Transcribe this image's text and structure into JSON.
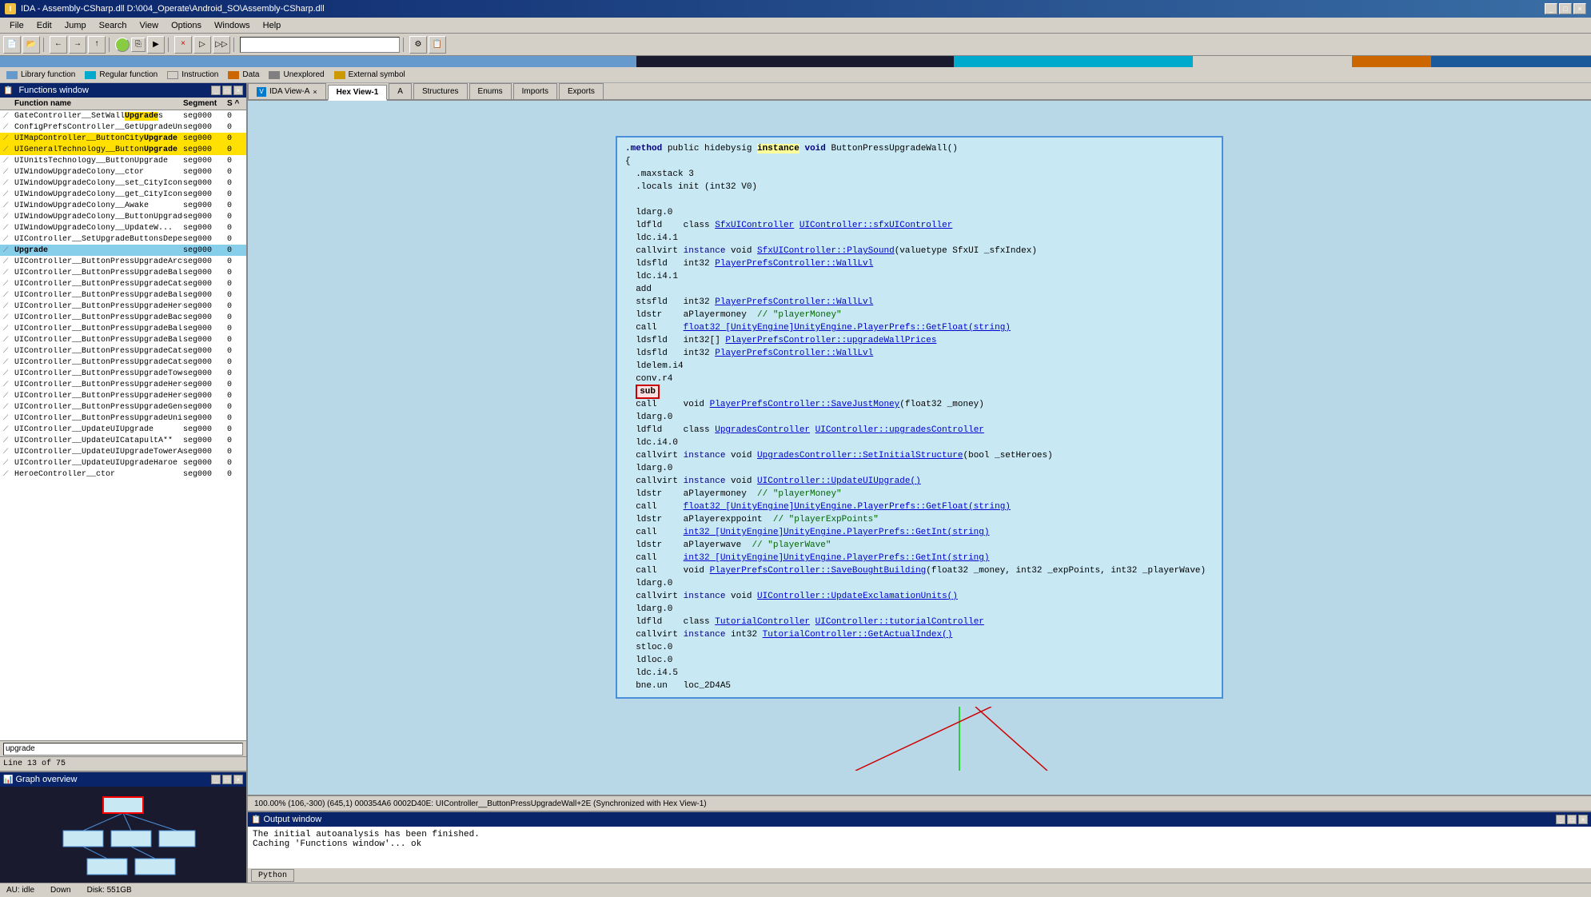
{
  "window": {
    "title": "IDA - Assembly-CSharp.dll D:\\004_Operate\\Android_SO\\Assembly-CSharp.dll"
  },
  "menu": {
    "items": [
      "File",
      "Edit",
      "Jump",
      "Search",
      "View",
      "Options",
      "Windows",
      "Help"
    ]
  },
  "legend": {
    "items": [
      {
        "label": "Library function",
        "color": "#6699cc"
      },
      {
        "label": "Regular function",
        "color": "#00aacc"
      },
      {
        "label": "Instruction",
        "color": "#d4d0c8"
      },
      {
        "label": "Data",
        "color": "#cc6600"
      },
      {
        "label": "Unexplored",
        "color": "#808080"
      },
      {
        "label": "External symbol",
        "color": "#cc9900"
      }
    ]
  },
  "functions_panel": {
    "title": "Functions window",
    "columns": [
      "Function name",
      "Segment",
      "S ^"
    ],
    "rows": [
      {
        "name": "GateController__SetWall",
        "highlight": "Upgrade",
        "seg": "seg000",
        "s": "0",
        "type": "fn"
      },
      {
        "name": "ConfigPrefsController__GetUpgradeUnit",
        "highlight": "Upgrade",
        "seg": "seg000",
        "s": "0",
        "type": "fn"
      },
      {
        "name": "UIMapController__ButtonCity",
        "highlight": "Upgrade",
        "seg": "seg000",
        "s": "0",
        "type": "fn",
        "bg": "yellow"
      },
      {
        "name": "UIGeneralTechnology__Button",
        "highlight": "Upgrade",
        "seg": "seg000",
        "s": "0",
        "type": "fn",
        "bg": "yellow"
      },
      {
        "name": "UIUnitsTechnology__ButtonUpgrade",
        "highlight": "",
        "seg": "seg000",
        "s": "0",
        "type": "fn"
      },
      {
        "name": "UIWindowUpgradeColony__ctor",
        "highlight": "",
        "seg": "seg000",
        "s": "0",
        "type": "fn"
      },
      {
        "name": "UIWindowUpgradeColony__set_CityIcon",
        "highlight": "",
        "seg": "seg000",
        "s": "0",
        "type": "fn"
      },
      {
        "name": "UIWindowUpgradeColony__get_CityIcon",
        "highlight": "",
        "seg": "seg000",
        "s": "0",
        "type": "fn"
      },
      {
        "name": "UIWindowUpgradeColony__Awake",
        "highlight": "",
        "seg": "seg000",
        "s": "0",
        "type": "fn"
      },
      {
        "name": "UIWindowUpgradeColony__ButtonUpgradeCity",
        "highlight": "",
        "seg": "seg000",
        "s": "0",
        "type": "fn"
      },
      {
        "name": "UIWindowUpgradeColony__UpdateWindow",
        "highlight": "",
        "seg": "seg000",
        "s": "0",
        "type": "fn"
      },
      {
        "name": "UIController__SetUpgradeButtonsDepend",
        "highlight": "",
        "seg": "seg000",
        "s": "0",
        "type": "fn"
      },
      {
        "name": "Upgrade",
        "highlight": "",
        "seg": "seg000",
        "s": "0",
        "type": "fn",
        "selected": true
      },
      {
        "name": "UIController__ButtonPressUpgradeArcher",
        "highlight": "",
        "seg": "seg000",
        "s": "0",
        "type": "fn"
      },
      {
        "name": "UIController__ButtonPressUpgradeBallista",
        "highlight": "",
        "seg": "seg000",
        "s": "0",
        "type": "fn"
      },
      {
        "name": "UIController__ButtonPressUpgradeCatapult",
        "highlight": "",
        "seg": "seg000",
        "s": "0",
        "type": "fn"
      },
      {
        "name": "UIController__ButtonPressUpgradeBalli**",
        "highlight": "",
        "seg": "seg000",
        "s": "0",
        "type": "fn"
      },
      {
        "name": "UIController__ButtonPressUpgradeHeroe",
        "highlight": "",
        "seg": "seg000",
        "s": "0",
        "type": "fn"
      },
      {
        "name": "UIController__ButtonPressUpgradeBack",
        "highlight": "",
        "seg": "seg000",
        "s": "0",
        "type": "fn"
      },
      {
        "name": "UIController__ButtonPressUpgradeBalli**",
        "highlight": "",
        "seg": "seg000",
        "s": "0",
        "type": "fn"
      },
      {
        "name": "UIController__ButtonPressUpgradeBalli**",
        "highlight": "",
        "seg": "seg000",
        "s": "0",
        "type": "fn"
      },
      {
        "name": "UIController__ButtonPressUpgradeCatap**",
        "highlight": "",
        "seg": "seg000",
        "s": "0",
        "type": "fn"
      },
      {
        "name": "UIController__ButtonPressUpgradeCatap**",
        "highlight": "",
        "seg": "seg000",
        "s": "0",
        "type": "fn"
      },
      {
        "name": "UIController__ButtonPressUpgradeTowerA**",
        "highlight": "",
        "seg": "seg000",
        "s": "0",
        "type": "fn"
      },
      {
        "name": "UIController__ButtonPressUpgradeHeroeBuy",
        "highlight": "",
        "seg": "seg000",
        "s": "0",
        "type": "fn"
      },
      {
        "name": "UIController__ButtonPressUpgradeHeroeS**",
        "highlight": "",
        "seg": "seg000",
        "s": "0",
        "type": "fn"
      },
      {
        "name": "UIController__ButtonPressUpgradeGeneral",
        "highlight": "",
        "seg": "seg000",
        "s": "0",
        "type": "fn"
      },
      {
        "name": "UIController__ButtonPressUpgradeUnits",
        "highlight": "",
        "seg": "seg000",
        "s": "0",
        "type": "fn"
      },
      {
        "name": "UIController__UpdateUIUpgrade",
        "highlight": "",
        "seg": "seg000",
        "s": "0",
        "type": "fn"
      },
      {
        "name": "UIController__UpdateUICatapultA**",
        "highlight": "",
        "seg": "seg000",
        "s": "0",
        "type": "fn"
      },
      {
        "name": "UIController__UpdateUIUpgradeTowerAmmo",
        "highlight": "",
        "seg": "seg000",
        "s": "0",
        "type": "fn"
      },
      {
        "name": "UIController__UpdateUIUpgradeHaroe",
        "highlight": "",
        "seg": "seg000",
        "s": "0",
        "type": "fn"
      },
      {
        "name": "HeroeController__ctor",
        "highlight": "",
        "seg": "seg000",
        "s": "0",
        "type": "fn"
      }
    ],
    "search": "upgrade",
    "line_count": "Line 13 of 75"
  },
  "graph_overview": {
    "title": "Graph overview"
  },
  "tabs": [
    {
      "label": "IDA View-A",
      "active": false,
      "closeable": true
    },
    {
      "label": "Hex View-1",
      "active": false
    },
    {
      "label": "A",
      "active": false
    },
    {
      "label": "Structures",
      "active": false
    },
    {
      "label": "Enums",
      "active": false
    },
    {
      "label": "Imports",
      "active": false
    },
    {
      "label": "Exports",
      "active": false
    }
  ],
  "code": {
    "method_header": ".method public hidebysig instance void ButtonPressUpgradeWall()",
    "lines": [
      "{",
      "  .maxstack 3",
      "  .locals init (int32 V0)",
      "",
      "  ldarg.0",
      "  ldfld    class SfxUIController UIController::sfxUIController",
      "  ldc.i4.1",
      "  callvirt instance void SfxUIController::PlaySound(valuetype SfxUI _sfxIndex)",
      "  ldsfld   int32 PlayerPrefsController::WallLvl",
      "  ldc.i4.1",
      "  add",
      "  stsfld   int32 PlayerPrefsController::WallLvl",
      "  ldstr    aPlayermoney  // \"playerMoney\"",
      "  call     float32 [UnityEngine]UnityEngine.PlayerPrefs::GetFloat(string)",
      "  ldsfld   int32[] PlayerPrefsController::upgradeWallPrices",
      "  ldsfld   int32 PlayerPrefsController::WallLvl",
      "  ldelem.i4",
      "  conv.r4",
      "  sub",
      "  call     void PlayerPrefsController::SaveJustMoney(float32 _money)",
      "  ldarg.0",
      "  ldfld    class UpgradesController UIController::upgradesController",
      "  ldc.i4.0",
      "  callvirt instance void UpgradesController::SetInitialStructure(bool _setHeroes)",
      "  ldarg.0",
      "  callvirt instance void UIController::UpdateUIUpgrade()",
      "  ldstr    aPlayermoney  // \"playerMoney\"",
      "  call     float32 [UnityEngine]UnityEngine.PlayerPrefs::GetFloat(string)",
      "  ldstr    aPlayerexppoint  // \"playerExpPoints\"",
      "  call     int32 [UnityEngine]UnityEngine.PlayerPrefs::GetInt(string)",
      "  ldstr    aPlayerwave  // \"playerWave\"",
      "  call     int32 [UnityEngine]UnityEngine.PlayerPrefs::GetInt(string)",
      "  call     void PlayerPrefsController::SaveBoughtBuilding(float32 _money, int32 _expPoints, int32 _playerWave)",
      "  ldarg.0",
      "  callvirt instance void UIController::UpdateExclamationUnits()",
      "  ldarg.0",
      "  ldfld    class TutorialController UIController::tutorialController",
      "  callvirt instance int32 TutorialController::GetActualIndex()",
      "  stloc.0",
      "  ldloc.0",
      "  ldc.i4.5",
      "  bne.un   loc_2D4A5"
    ],
    "highlighted_line_index": 18,
    "highlighted_word": "sub"
  },
  "status_bar": {
    "text": "100.00% (106,-300)  (645,1) 000354A6 0002D40E: UIController__ButtonPressUpgradeWall+2E (Synchronized with Hex View-1)"
  },
  "output": {
    "title": "Output window",
    "lines": [
      "The initial autoanalysis has been finished.",
      "Caching 'Functions window'... ok"
    ],
    "tab": "Python"
  },
  "bottom_status": {
    "au": "AU: idle",
    "down": "Down",
    "disk": "Disk: 551GB"
  }
}
